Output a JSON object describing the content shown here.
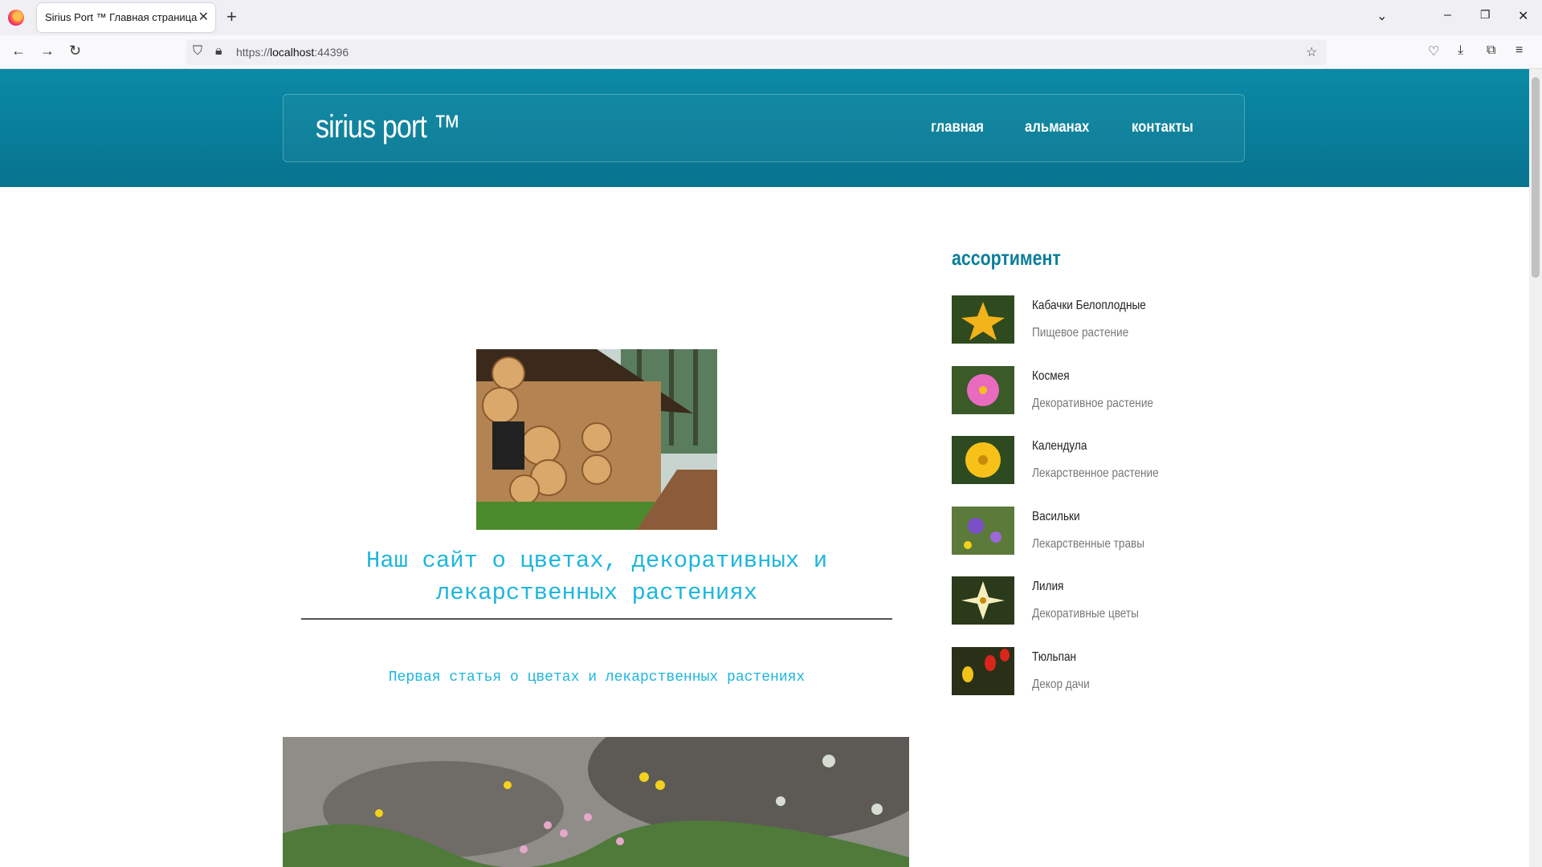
{
  "browser": {
    "tab_title": "Sirius Port ™ Главная страница",
    "tab_close": "✕",
    "new_tab": "+",
    "url_prefix": "https://",
    "url_host": "localhost",
    "url_port": ":44396"
  },
  "header": {
    "logo": "sirius port ™",
    "menu": [
      "главная",
      "альманах",
      "контакты"
    ]
  },
  "main": {
    "heading": "Наш сайт о цветах, декоративных и лекарственных растениях",
    "subheading": "Первая статья о цветах и лекарственных растениях"
  },
  "sidebar": {
    "title": "ассортимент",
    "items": [
      {
        "name": "Кабачки Белоплодные",
        "desc": "Пищевое растение",
        "color": "#f2b21a"
      },
      {
        "name": "Космея",
        "desc": "Декоративное растение",
        "color": "#e86bc0"
      },
      {
        "name": "Календула",
        "desc": "Лекарственное растение",
        "color": "#f6c21a"
      },
      {
        "name": "Васильки",
        "desc": "Лекарственные травы",
        "color": "#7b4fc8"
      },
      {
        "name": "Лилия",
        "desc": "Декоративные цветы",
        "color": "#f4eebd"
      },
      {
        "name": "Тюльпан",
        "desc": "Декор дачи",
        "color": "#d8261d"
      }
    ]
  },
  "colors": {
    "header": "#0a8aa6",
    "accent": "#1fb6dc",
    "sidebar_title": "#0a7f9a"
  }
}
